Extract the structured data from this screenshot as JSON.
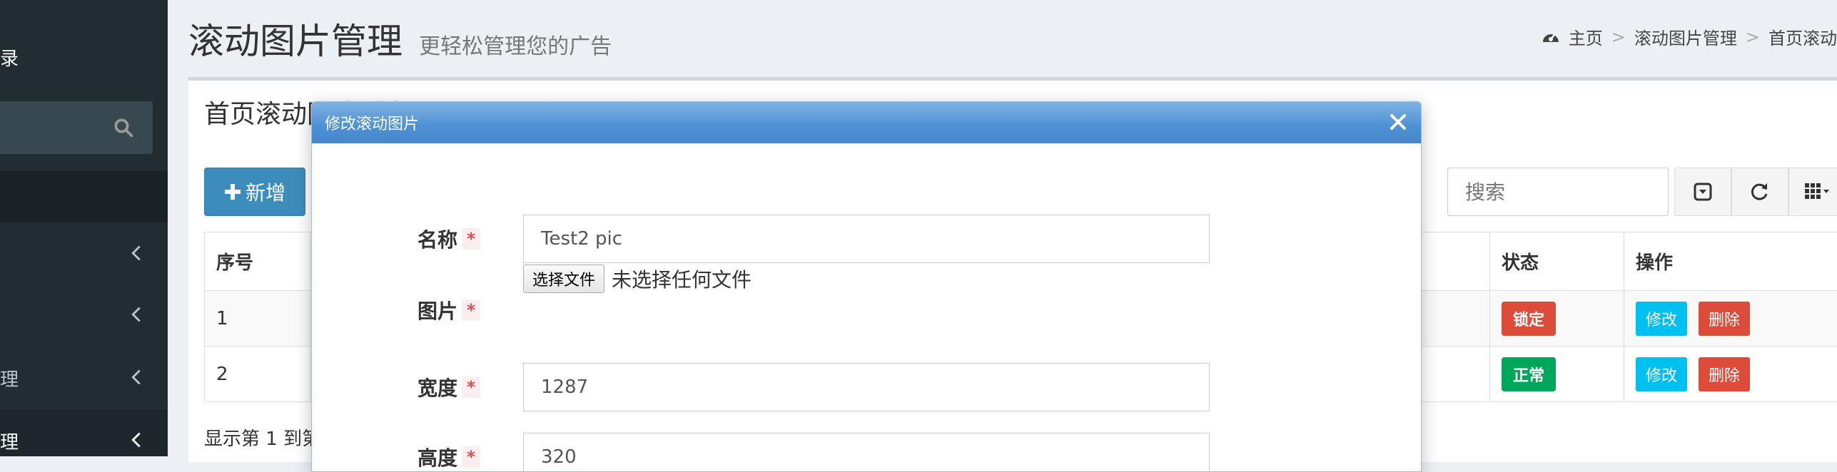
{
  "sidebar": {
    "user_fragment": "录",
    "search_icon": "search-icon",
    "menu": [
      {
        "label": "",
        "chevron": "chevron-left-icon"
      },
      {
        "label": "",
        "chevron": "chevron-left-icon"
      },
      {
        "label": "理",
        "chevron": "chevron-left-icon"
      },
      {
        "label": "理",
        "chevron": "chevron-left-icon"
      }
    ]
  },
  "header": {
    "title": "滚动图片管理",
    "subtitle": "更轻松管理您的广告"
  },
  "breadcrumb": {
    "icon": "dashboard-icon",
    "items": [
      "主页",
      "滚动图片管理",
      "首页滚动"
    ],
    "separator": ">"
  },
  "box": {
    "title": "首页滚动图片列表",
    "add_button": "新增",
    "search_placeholder": "搜索",
    "toolbar_icons": [
      "toggle-icon",
      "refresh-icon",
      "columns-icon"
    ]
  },
  "table": {
    "headers": {
      "index": "序号",
      "status": "状态",
      "actions": "操作"
    },
    "rows": [
      {
        "index": "1",
        "status": "锁定",
        "status_color": "#dd4b39",
        "edit": "修改",
        "delete": "删除"
      },
      {
        "index": "2",
        "status": "正常",
        "status_color": "#00a65a",
        "edit": "修改",
        "delete": "删除"
      }
    ]
  },
  "pager": {
    "info": "显示第 1 到第"
  },
  "modal": {
    "title": "修改滚动图片",
    "fields": {
      "name_label": "名称",
      "name_value": "Test2 pic",
      "image_label": "图片",
      "file_button": "选择文件",
      "file_status": "未选择任何文件",
      "width_label": "宽度",
      "width_value": "1287",
      "height_label": "高度",
      "height_value": "320",
      "required_mark": "*"
    }
  },
  "colors": {
    "sidebar_bg": "#222d32",
    "primary": "#3c8dbc",
    "danger": "#dd4b39",
    "success": "#00a65a",
    "info": "#00c0ef"
  }
}
